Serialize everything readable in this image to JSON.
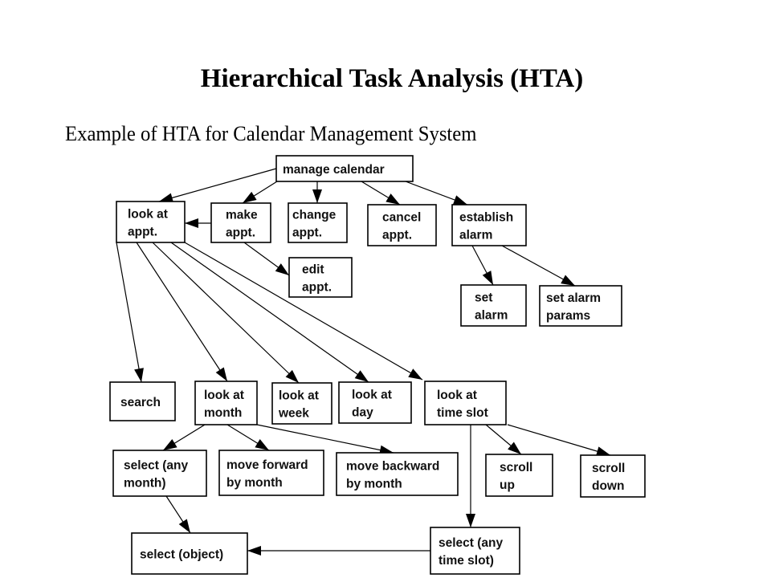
{
  "title": "Hierarchical Task Analysis (HTA)",
  "subtitle": "Example of HTA for Calendar Management System",
  "nodes": [
    {
      "id": "manage-calendar",
      "lines": [
        "manage calendar"
      ]
    },
    {
      "id": "look-at-appt",
      "lines": [
        "look at",
        "appt."
      ]
    },
    {
      "id": "make-appt",
      "lines": [
        "make",
        "appt."
      ]
    },
    {
      "id": "change-appt",
      "lines": [
        "change",
        "appt."
      ]
    },
    {
      "id": "cancel-appt",
      "lines": [
        "cancel",
        "appt."
      ]
    },
    {
      "id": "establish-alarm",
      "lines": [
        "establish",
        "alarm"
      ]
    },
    {
      "id": "edit-appt",
      "lines": [
        "edit",
        "appt."
      ]
    },
    {
      "id": "set-alarm",
      "lines": [
        "set",
        "alarm"
      ]
    },
    {
      "id": "set-alarm-params",
      "lines": [
        "set alarm",
        "params"
      ]
    },
    {
      "id": "search",
      "lines": [
        "search"
      ]
    },
    {
      "id": "look-at-month",
      "lines": [
        "look at",
        "month"
      ]
    },
    {
      "id": "look-at-week",
      "lines": [
        "look at",
        "week"
      ]
    },
    {
      "id": "look-at-day",
      "lines": [
        "look at",
        "day"
      ]
    },
    {
      "id": "look-at-time-slot",
      "lines": [
        "look at",
        "time slot"
      ]
    },
    {
      "id": "select-any-month",
      "lines": [
        "select (any",
        "month)"
      ]
    },
    {
      "id": "move-forward-by-month",
      "lines": [
        "move forward",
        "by month"
      ]
    },
    {
      "id": "move-backward-by-month",
      "lines": [
        "move backward",
        "by month"
      ]
    },
    {
      "id": "scroll-up",
      "lines": [
        "scroll",
        "up"
      ]
    },
    {
      "id": "scroll-down",
      "lines": [
        "scroll",
        "down"
      ]
    },
    {
      "id": "select-object",
      "lines": [
        "select (object)"
      ]
    },
    {
      "id": "select-any-time-slot",
      "lines": [
        "select (any",
        "time slot)"
      ]
    }
  ],
  "edges": [
    {
      "from": "manage-calendar",
      "to": "look-at-appt"
    },
    {
      "from": "manage-calendar",
      "to": "make-appt"
    },
    {
      "from": "manage-calendar",
      "to": "change-appt"
    },
    {
      "from": "manage-calendar",
      "to": "cancel-appt"
    },
    {
      "from": "manage-calendar",
      "to": "establish-alarm"
    },
    {
      "from": "make-appt",
      "to": "look-at-appt"
    },
    {
      "from": "make-appt",
      "to": "edit-appt"
    },
    {
      "from": "establish-alarm",
      "to": "set-alarm"
    },
    {
      "from": "establish-alarm",
      "to": "set-alarm-params"
    },
    {
      "from": "look-at-appt",
      "to": "search"
    },
    {
      "from": "look-at-appt",
      "to": "look-at-month"
    },
    {
      "from": "look-at-appt",
      "to": "look-at-week"
    },
    {
      "from": "look-at-appt",
      "to": "look-at-day"
    },
    {
      "from": "look-at-appt",
      "to": "look-at-time-slot"
    },
    {
      "from": "look-at-month",
      "to": "select-any-month"
    },
    {
      "from": "look-at-month",
      "to": "move-forward-by-month"
    },
    {
      "from": "look-at-month",
      "to": "move-backward-by-month"
    },
    {
      "from": "look-at-time-slot",
      "to": "scroll-up"
    },
    {
      "from": "look-at-time-slot",
      "to": "scroll-down"
    },
    {
      "from": "look-at-time-slot",
      "to": "select-any-time-slot"
    },
    {
      "from": "select-any-month",
      "to": "select-object"
    },
    {
      "from": "select-any-time-slot",
      "to": "select-object"
    }
  ]
}
